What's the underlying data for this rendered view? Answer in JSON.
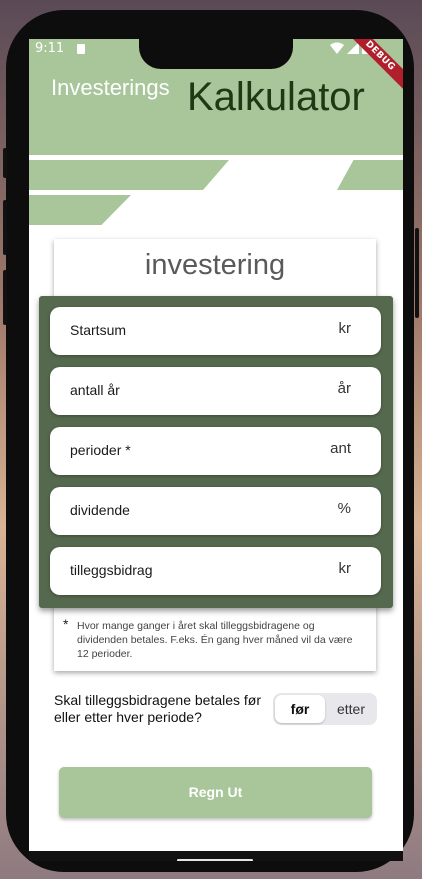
{
  "statusbar": {
    "time": "9:11",
    "debug_label": "DEBUG"
  },
  "header": {
    "title_small": "Investerings",
    "title_big": "Kalkulator"
  },
  "card": {
    "title": "investering"
  },
  "fields": [
    {
      "label": "Startsum",
      "unit": "kr"
    },
    {
      "label": "antall år",
      "unit": "år"
    },
    {
      "label": "perioder *",
      "unit": "ant"
    },
    {
      "label": "dividende",
      "unit": "%"
    },
    {
      "label": "tilleggsbidrag",
      "unit": "kr"
    }
  ],
  "footnote": {
    "star": "*",
    "text": "Hvor mange ganger i året skal tilleggsbidragene og dividenden betales. F.eks.  Én gang hver måned vil da være 12 perioder."
  },
  "question": "Skal tilleggsbidragene betales før eller etter hver periode?",
  "toggle": {
    "before": "før",
    "after": "etter",
    "selected": "før"
  },
  "calculate_button": "Regn Ut",
  "colors": {
    "accent": "#a8c69a",
    "panel": "#55694e",
    "title_dark": "#1d3a14"
  }
}
